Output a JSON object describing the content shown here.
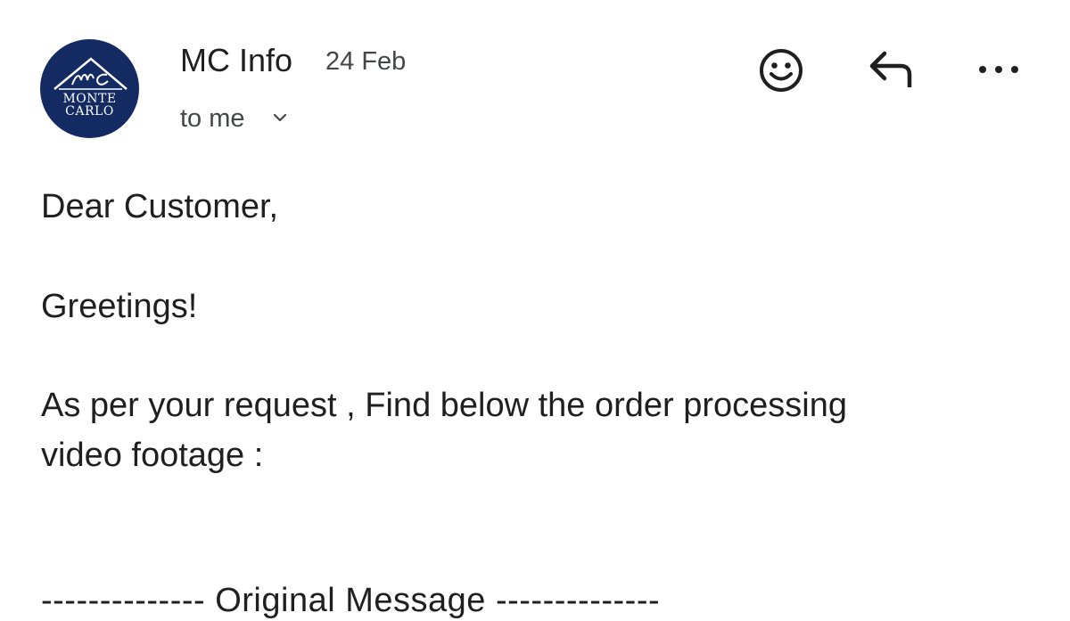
{
  "email": {
    "sender": "MC Info",
    "date": "24 Feb",
    "recipient": "to me",
    "avatar_logo": {
      "line1": "MONTE",
      "line2": "CARLO",
      "monogram": "MC",
      "color": "#142a63"
    }
  },
  "actions": {
    "emoji_icon": "smiley-icon",
    "reply_icon": "reply-icon",
    "more_icon": "more-options-icon"
  },
  "body": {
    "greeting": "Dear Customer,",
    "greetings": "Greetings!",
    "message_line1": "As per your request , Find below the order processing",
    "message_line2": "video footage :",
    "separator": "-------------- Original Message --------------"
  }
}
